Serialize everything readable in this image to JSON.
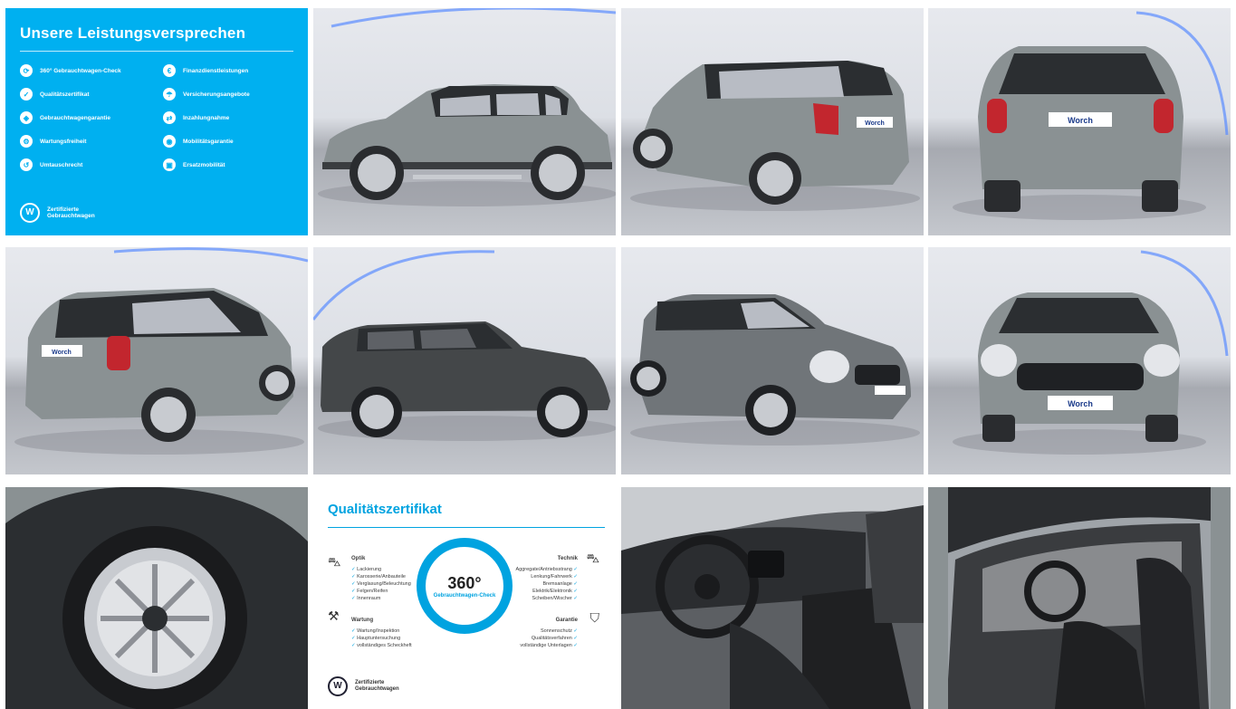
{
  "promise": {
    "title": "Unsere Leistungsversprechen",
    "items": [
      {
        "label": "360° Gebrauchtwagen-Check",
        "icon": "360-check-icon"
      },
      {
        "label": "Finanzdienstleistungen",
        "icon": "finance-icon"
      },
      {
        "label": "Qualitätszertifikat",
        "icon": "certificate-icon"
      },
      {
        "label": "Versicherungsangebote",
        "icon": "insurance-icon"
      },
      {
        "label": "Gebrauchtwagengarantie",
        "icon": "warranty-icon"
      },
      {
        "label": "Inzahlungnahme",
        "icon": "trade-in-icon"
      },
      {
        "label": "Wartungsfreiheit",
        "icon": "maintenance-icon"
      },
      {
        "label": "Mobilitätsgarantie",
        "icon": "mobility-icon"
      },
      {
        "label": "Umtauschrecht",
        "icon": "exchange-icon"
      },
      {
        "label": "Ersatzmobilität",
        "icon": "replacement-car-icon"
      }
    ],
    "brand_line1": "Zertifizierte",
    "brand_line2": "Gebrauchtwagen",
    "logo_text": "W"
  },
  "plate_text": "Worch",
  "quality": {
    "title": "Qualitätszertifikat",
    "ring_number": "360°",
    "ring_text": "Gebrauchtwagen-Check",
    "optik": {
      "heading": "Optik",
      "items": [
        "Lackierung",
        "Karosserie/Anbauteile",
        "Verglasung/Beleuchtung",
        "Felgen/Reifen",
        "Innenraum"
      ]
    },
    "wartung": {
      "heading": "Wartung",
      "items": [
        "Wartung/Inspektion",
        "Hauptuntersuchung",
        "vollständiges Scheckheft"
      ]
    },
    "technik": {
      "heading": "Technik",
      "items": [
        "Aggregate/Antriebsstrang",
        "Lenkung/Fahrwerk",
        "Bremsanlage",
        "Elektrik/Elektronik",
        "Scheiben/Wischer"
      ]
    },
    "garantie": {
      "heading": "Garantie",
      "items": [
        "Sonnenschutz",
        "Qualitätsverfahren",
        "vollständige Unterlagen"
      ]
    },
    "brand_line1": "Zertifizierte",
    "brand_line2": "Gebrauchtwagen",
    "logo_text": "W"
  },
  "colors": {
    "accent": "#00b0f0",
    "car_body": "#8a9193",
    "car_roof": "#2b2e31"
  }
}
